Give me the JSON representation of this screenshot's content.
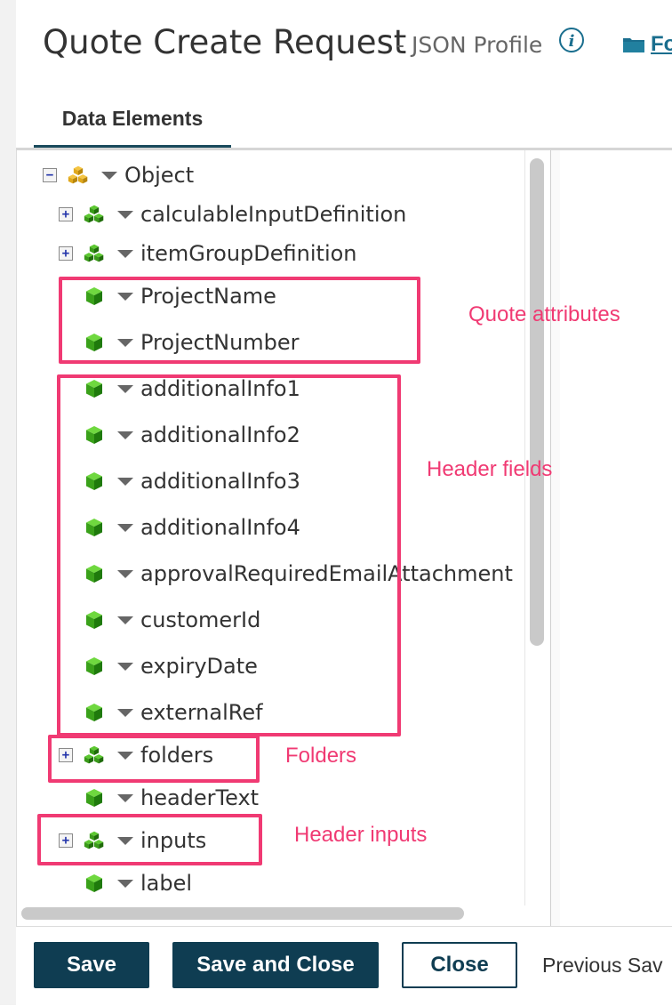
{
  "header": {
    "title": "Quote Create Request",
    "subtitle": "- JSON Profile",
    "info_icon": "info-circle-icon",
    "folder_icon": "folder-icon",
    "folder_link": "Fo"
  },
  "tabs": [
    {
      "label": "Data Elements",
      "active": true
    }
  ],
  "tree": {
    "rows": [
      {
        "label": "Object",
        "expander": "−",
        "node_type": "object-node-icon"
      },
      {
        "label": "calculableInputDefinition",
        "expander": "+",
        "node_type": "object-node-icon"
      },
      {
        "label": "itemGroupDefinition",
        "expander": "+",
        "node_type": "object-node-icon"
      },
      {
        "label": "ProjectName",
        "expander": "",
        "node_type": "element-node-icon"
      },
      {
        "label": "ProjectNumber",
        "expander": "",
        "node_type": "element-node-icon"
      },
      {
        "label": "additionalInfo1",
        "expander": "",
        "node_type": "element-node-icon"
      },
      {
        "label": "additionalInfo2",
        "expander": "",
        "node_type": "element-node-icon"
      },
      {
        "label": "additionalInfo3",
        "expander": "",
        "node_type": "element-node-icon"
      },
      {
        "label": "additionalInfo4",
        "expander": "",
        "node_type": "element-node-icon"
      },
      {
        "label": "approvalRequiredEmailAttachment",
        "expander": "",
        "node_type": "element-node-icon"
      },
      {
        "label": "customerId",
        "expander": "",
        "node_type": "element-node-icon"
      },
      {
        "label": "expiryDate",
        "expander": "",
        "node_type": "element-node-icon"
      },
      {
        "label": "externalRef",
        "expander": "",
        "node_type": "element-node-icon"
      },
      {
        "label": "folders",
        "expander": "+",
        "node_type": "object-node-icon"
      },
      {
        "label": "headerText",
        "expander": "",
        "node_type": "element-node-icon"
      },
      {
        "label": "inputs",
        "expander": "+",
        "node_type": "object-node-icon"
      },
      {
        "label": "label",
        "expander": "",
        "node_type": "element-node-icon"
      }
    ]
  },
  "annotations": {
    "quote_attributes": "Quote attributes",
    "header_fields": "Header fields",
    "folders": "Folders",
    "header_inputs": "Header inputs",
    "color": "#f03a73"
  },
  "footer": {
    "save": "Save",
    "save_and_close": "Save and Close",
    "close": "Close",
    "previous_saved": "Previous Sav"
  },
  "colors": {
    "primary": "#0f3d52",
    "link": "#1a6e8e",
    "tab_underline": "#1a4a5c"
  }
}
